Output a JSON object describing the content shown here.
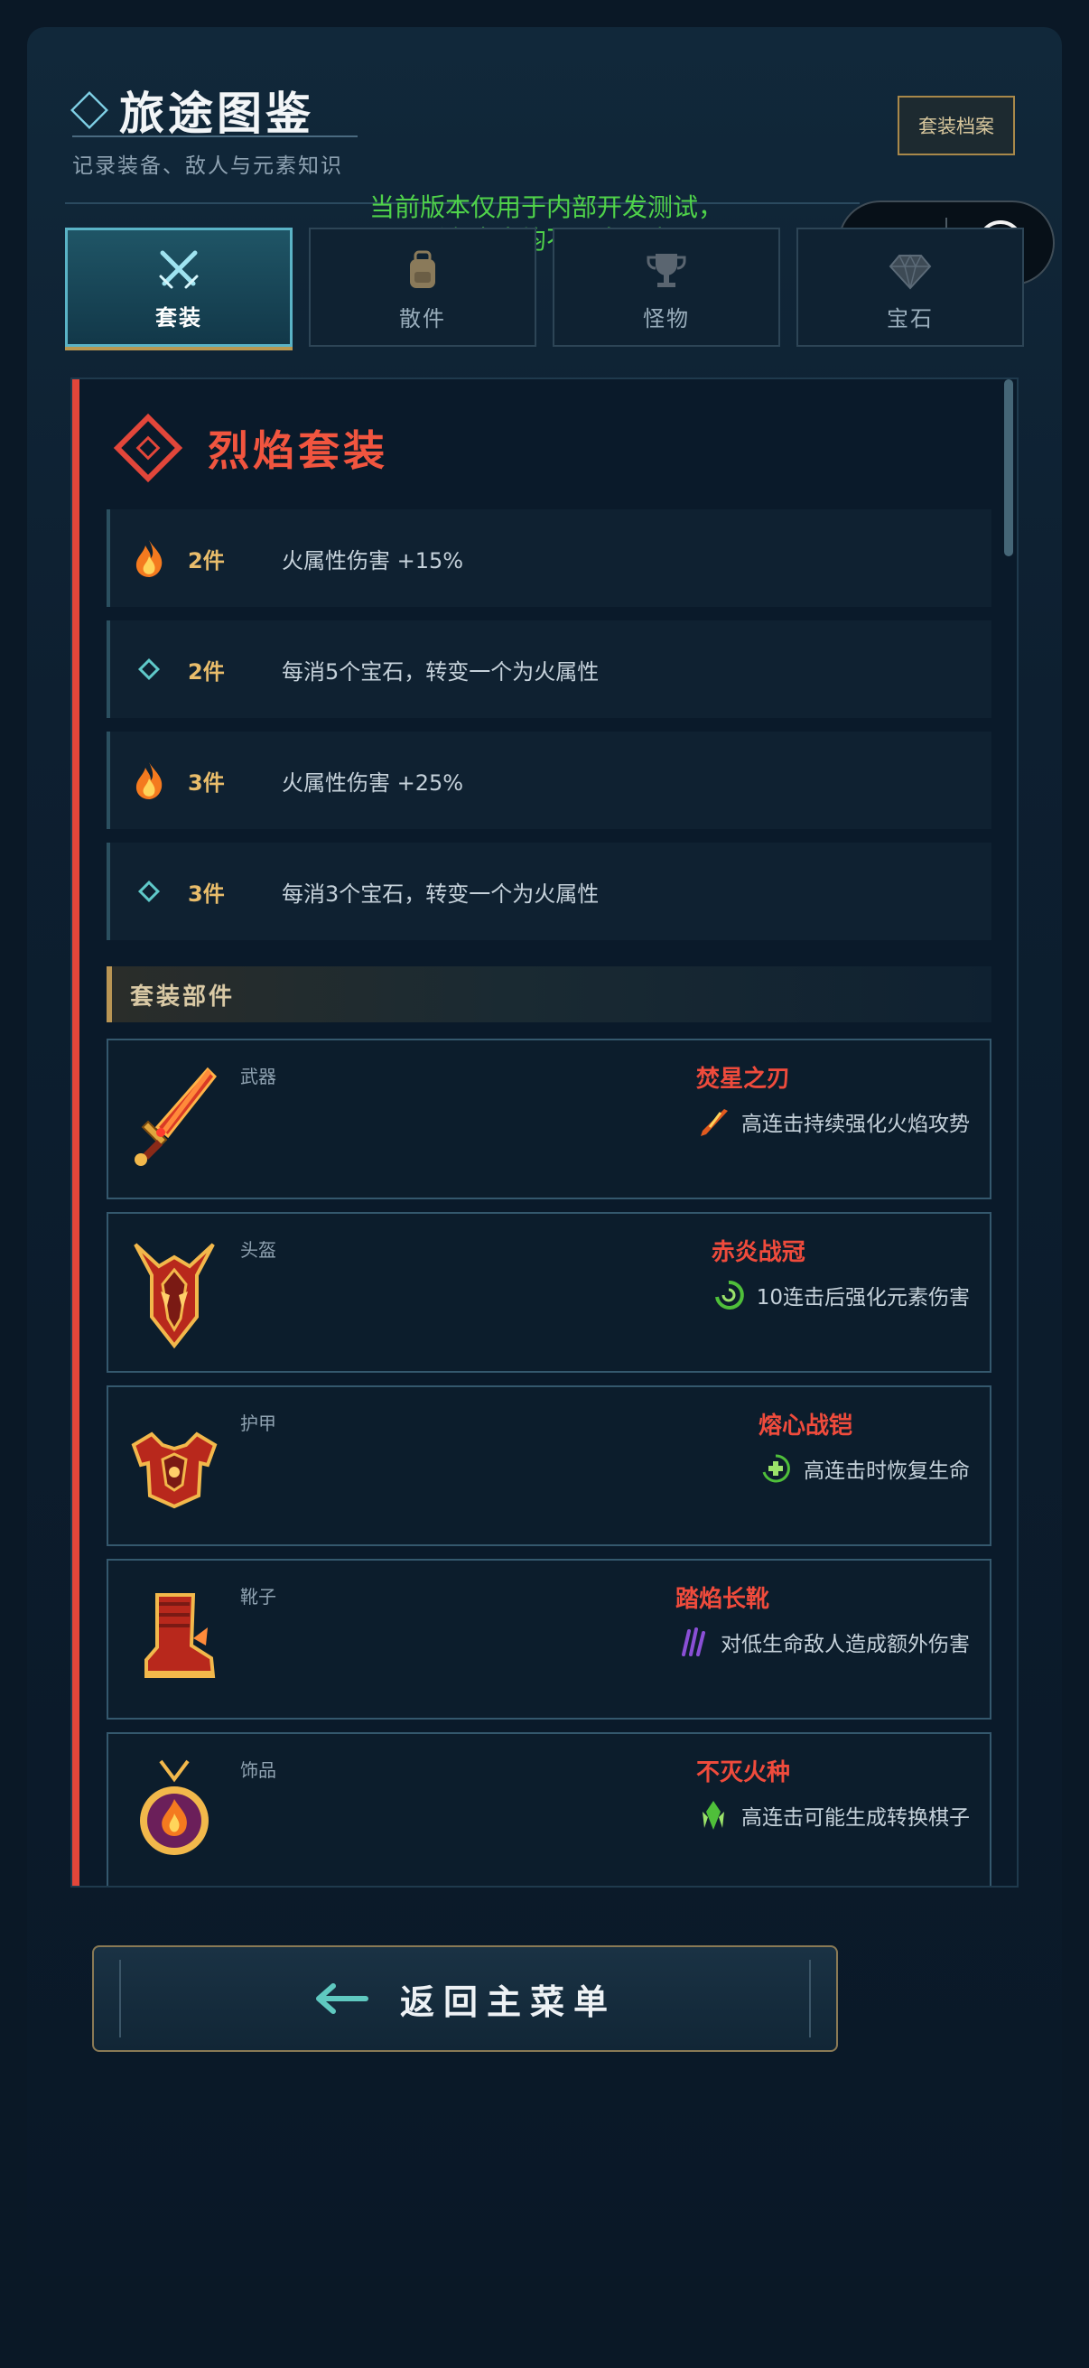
{
  "header": {
    "title": "旅途图鉴",
    "subtitle": "记录装备、敌人与元素知识",
    "archive_button": "套装档案"
  },
  "dev_notice": {
    "line1": "当前版本仅用于内部开发测试，",
    "line2": "所有内容均不面向用户"
  },
  "tabs": [
    {
      "label": "套装",
      "icon": "crossed-swords-icon",
      "active": true
    },
    {
      "label": "散件",
      "icon": "backpack-icon",
      "active": false
    },
    {
      "label": "怪物",
      "icon": "trophy-icon",
      "active": false
    },
    {
      "label": "宝石",
      "icon": "gem-icon",
      "active": false
    }
  ],
  "set": {
    "name": "烈焰套装",
    "icon": "fire-diamond-icon",
    "bonuses": [
      {
        "count": "2件",
        "text": "火属性伤害 +15%",
        "icon": "flame-icon"
      },
      {
        "count": "2件",
        "text": "每消5个宝石，转变一个为火属性",
        "icon": "diamond-outline-icon"
      },
      {
        "count": "3件",
        "text": "火属性伤害 +25%",
        "icon": "flame-icon"
      },
      {
        "count": "3件",
        "text": "每消3个宝石，转变一个为火属性",
        "icon": "diamond-outline-icon"
      }
    ],
    "parts_title": "套装部件",
    "parts": [
      {
        "slot": "武器",
        "name": "焚星之刃",
        "effect": "高连击持续强化火焰攻势",
        "icon": "sword-icon",
        "effect_icon": "fire-slash-icon"
      },
      {
        "slot": "头盔",
        "name": "赤炎战冠",
        "effect": "10连击后强化元素伤害",
        "icon": "helmet-icon",
        "effect_icon": "green-swirl-icon"
      },
      {
        "slot": "护甲",
        "name": "熔心战铠",
        "effect": "高连击时恢复生命",
        "icon": "chest-armor-icon",
        "effect_icon": "green-heal-icon"
      },
      {
        "slot": "靴子",
        "name": "踏焰长靴",
        "effect": "对低生命敌人造成额外伤害",
        "icon": "boots-icon",
        "effect_icon": "purple-claw-icon"
      },
      {
        "slot": "饰品",
        "name": "不灭火种",
        "effect": "高连击可能生成转换棋子",
        "icon": "amulet-icon",
        "effect_icon": "green-crystal-icon"
      }
    ]
  },
  "footer": {
    "return_button": "返回主菜单",
    "return_icon": "arrow-left-icon"
  },
  "colors": {
    "accent_red": "#e2463a",
    "gold": "#b99554",
    "teal": "#5ab3c6",
    "dev_text": "#4fd24a"
  }
}
